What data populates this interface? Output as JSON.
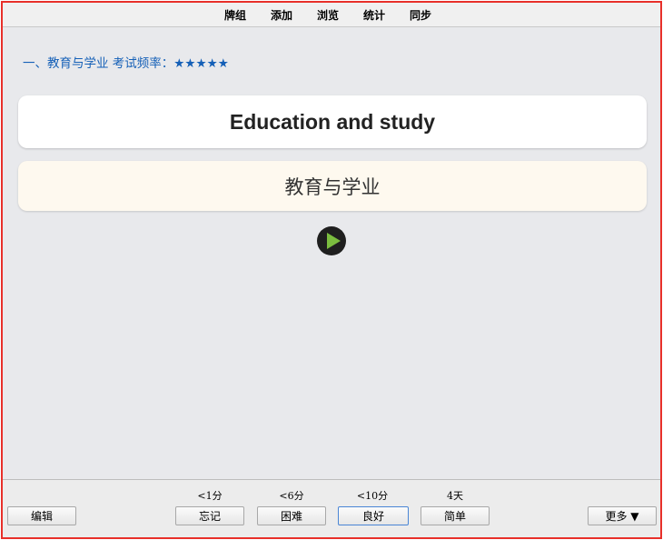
{
  "top_menu": {
    "items": [
      {
        "label": "牌组"
      },
      {
        "label": "添加"
      },
      {
        "label": "浏览"
      },
      {
        "label": "统计"
      },
      {
        "label": "同步"
      }
    ]
  },
  "card": {
    "frequency_label": "一、教育与学业 考试频率：★★★★★",
    "front": "Education and study",
    "back": "教育与学业",
    "play_icon": "play-icon"
  },
  "bottom": {
    "edit_label": "编辑",
    "more_label": "更多 ▼",
    "answers": [
      {
        "interval": "<1分",
        "label": "忘记"
      },
      {
        "interval": "<6分",
        "label": "困难"
      },
      {
        "interval": "<10分",
        "label": "良好"
      },
      {
        "interval": "4天",
        "label": "简单"
      }
    ]
  },
  "colors": {
    "frame_border": "#e8302a",
    "frequency_text": "#1560b7",
    "back_card": "#fef9ef",
    "play_triangle": "#7bbd3f"
  }
}
